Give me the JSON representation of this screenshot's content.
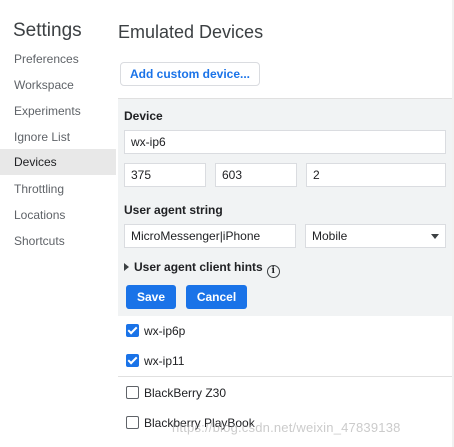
{
  "sidebar": {
    "title": "Settings",
    "items": [
      {
        "label": "Preferences",
        "active": false
      },
      {
        "label": "Workspace",
        "active": false
      },
      {
        "label": "Experiments",
        "active": false
      },
      {
        "label": "Ignore List",
        "active": false
      },
      {
        "label": "Devices",
        "active": true
      },
      {
        "label": "Throttling",
        "active": false
      },
      {
        "label": "Locations",
        "active": false
      },
      {
        "label": "Shortcuts",
        "active": false
      }
    ]
  },
  "main": {
    "title": "Emulated Devices",
    "add_button": "Add custom device..."
  },
  "editor": {
    "device_label": "Device",
    "device_name": "wx-ip6",
    "width": "375",
    "height": "603",
    "pixel_ratio": "2",
    "ua_label": "User agent string",
    "ua_value": "MicroMessenger|iPhone",
    "ua_type": "Mobile",
    "hints_label": "User agent client hints",
    "save_label": "Save",
    "cancel_label": "Cancel"
  },
  "devices": [
    {
      "name": "wx-ip6p",
      "checked": true
    },
    {
      "name": "wx-ip11",
      "checked": true
    },
    {
      "name": "BlackBerry Z30",
      "checked": false
    },
    {
      "name": "Blackberry PlayBook",
      "checked": false
    }
  ],
  "watermark": "https://blog.csdn.net/weixin_47839138",
  "colors": {
    "accent": "#1a73e8",
    "active_nav": "#e8e8e8",
    "editor_bg": "#f1f3f4"
  }
}
